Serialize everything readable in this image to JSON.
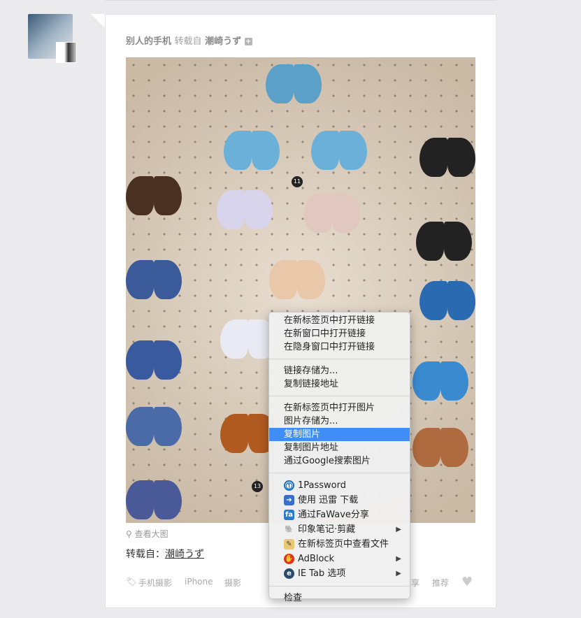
{
  "post": {
    "author": "别人的手机",
    "reblog_label": "转载自",
    "source_author": "潮崎うず",
    "plus_icon": "+",
    "photo_badges": [
      "11",
      "13"
    ],
    "view_large": "查看大图",
    "source_prefix": "转载自：",
    "source_link": "潮崎うず",
    "tags": [
      "手机摄影",
      "iPhone",
      "摄影"
    ],
    "actions": {
      "share": "分享",
      "recommend": "推荐"
    }
  },
  "context_menu": {
    "groups": [
      [
        {
          "label": "在新标签页中打开链接"
        },
        {
          "label": "在新窗口中打开链接"
        },
        {
          "label": "在隐身窗口中打开链接"
        }
      ],
      [
        {
          "label": "链接存储为..."
        },
        {
          "label": "复制链接地址"
        }
      ],
      [
        {
          "label": "在新标签页中打开图片"
        },
        {
          "label": "图片存储为..."
        },
        {
          "label": "复制图片",
          "selected": true
        },
        {
          "label": "复制图片地址"
        },
        {
          "label": "通过Google搜索图片"
        }
      ],
      [
        {
          "label": "1Password",
          "icon": "1password-icon"
        },
        {
          "label": "使用 迅雷 下载",
          "icon": "thunder-download-icon"
        },
        {
          "label": "通过FaWave分享",
          "icon": "fawave-icon"
        },
        {
          "label": "印象笔记·剪藏",
          "icon": "evernote-icon",
          "submenu": true
        },
        {
          "label": "在新标签页中查看文件",
          "icon": "file-viewer-icon"
        },
        {
          "label": "AdBlock",
          "icon": "adblock-icon",
          "submenu": true
        },
        {
          "label": "IE Tab 选项",
          "icon": "ie-tab-icon",
          "submenu": true
        }
      ],
      [
        {
          "label": "检查"
        }
      ]
    ],
    "highlight_color": "#3f8ef7"
  }
}
